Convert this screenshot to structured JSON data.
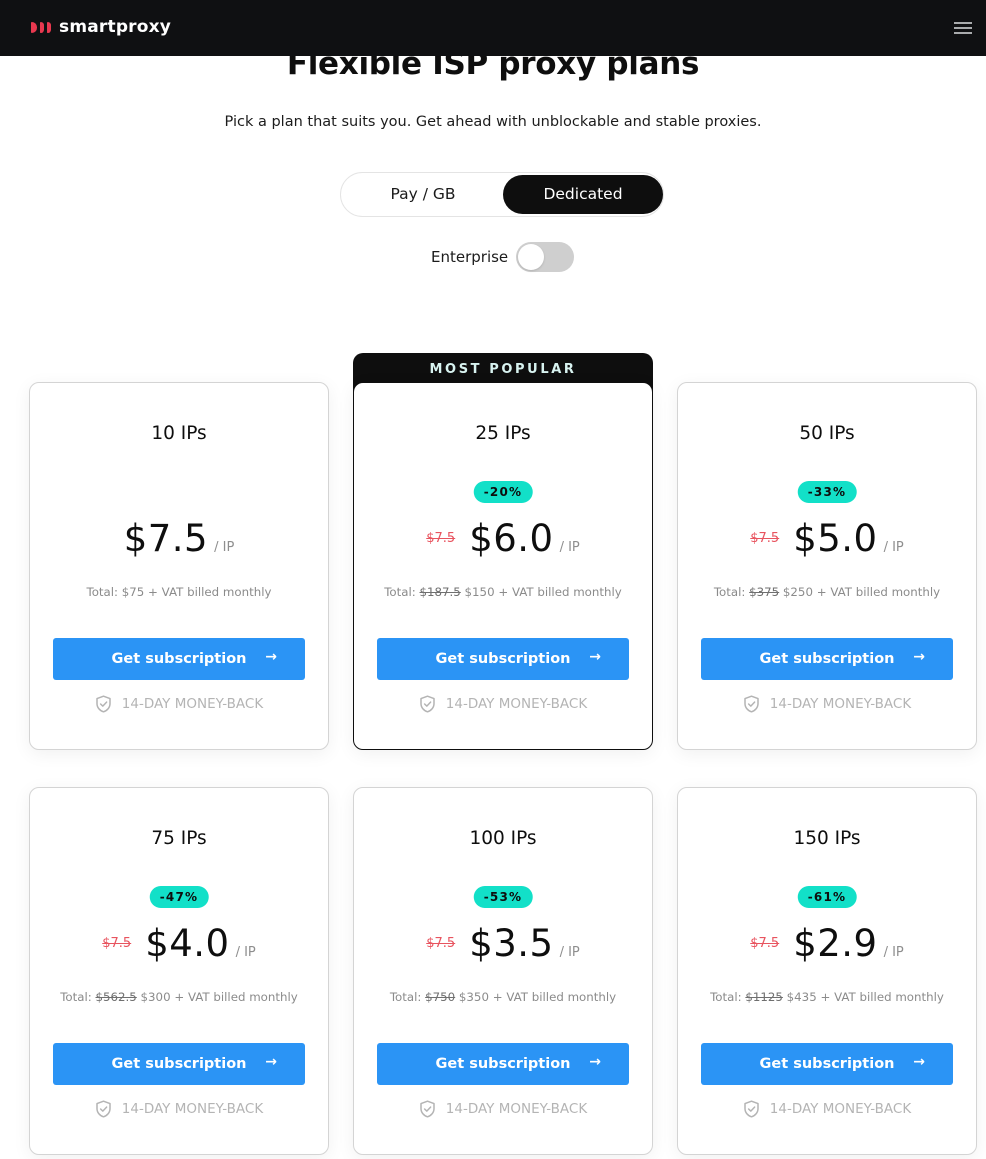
{
  "header": {
    "brand": "smartproxy",
    "logo_icon": "smartproxy-logo-icon",
    "menu_icon": "hamburger-menu-icon",
    "brand_color": "#e8384f"
  },
  "hero": {
    "title": "Flexible ISP proxy plans",
    "subtitle": "Pick a plan that suits you. Get ahead with unblockable and stable proxies."
  },
  "plan_type_toggle": {
    "options": [
      {
        "label": "Pay / GB",
        "selected": false
      },
      {
        "label": "Dedicated",
        "selected": true
      }
    ]
  },
  "enterprise_switch": {
    "label": "Enterprise",
    "on": false
  },
  "popular_label": "MOST POPULAR",
  "plans": [
    {
      "title": "10 IPs",
      "badge": null,
      "old_price": null,
      "price": "$7.5",
      "per": "/ IP",
      "total_prefix": "Total:",
      "total_old": null,
      "total_text": "$75 + VAT billed monthly",
      "cta": "Get subscription",
      "guarantee": "14-DAY MONEY-BACK",
      "popular": false
    },
    {
      "title": "25 IPs",
      "badge": "-20%",
      "old_price": "$7.5",
      "price": "$6.0",
      "per": "/ IP",
      "total_prefix": "Total:",
      "total_old": "$187.5",
      "total_text": "$150 + VAT billed monthly",
      "cta": "Get subscription",
      "guarantee": "14-DAY MONEY-BACK",
      "popular": true
    },
    {
      "title": "50 IPs",
      "badge": "-33%",
      "old_price": "$7.5",
      "price": "$5.0",
      "per": "/ IP",
      "total_prefix": "Total:",
      "total_old": "$375",
      "total_text": "$250 + VAT billed monthly",
      "cta": "Get subscription",
      "guarantee": "14-DAY MONEY-BACK",
      "popular": false
    },
    {
      "title": "75 IPs",
      "badge": "-47%",
      "old_price": "$7.5",
      "price": "$4.0",
      "per": "/ IP",
      "total_prefix": "Total:",
      "total_old": "$562.5",
      "total_text": "$300 + VAT billed monthly",
      "cta": "Get subscription",
      "guarantee": "14-DAY MONEY-BACK",
      "popular": false
    },
    {
      "title": "100 IPs",
      "badge": "-53%",
      "old_price": "$7.5",
      "price": "$3.5",
      "per": "/ IP",
      "total_prefix": "Total:",
      "total_old": "$750",
      "total_text": "$350 + VAT billed monthly",
      "cta": "Get subscription",
      "guarantee": "14-DAY MONEY-BACK",
      "popular": false
    },
    {
      "title": "150 IPs",
      "badge": "-61%",
      "old_price": "$7.5",
      "price": "$2.9",
      "per": "/ IP",
      "total_prefix": "Total:",
      "total_old": "$1125",
      "total_text": "$435 + VAT billed monthly",
      "cta": "Get subscription",
      "guarantee": "14-DAY MONEY-BACK",
      "popular": false
    }
  ],
  "colors": {
    "accent_button": "#2b94f5",
    "discount_badge": "#12e0c8",
    "old_price": "#e8545f"
  }
}
